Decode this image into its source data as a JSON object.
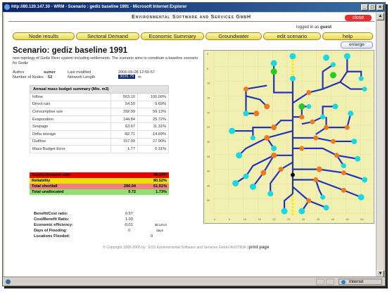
{
  "window": {
    "title": "http://80.120.147.30 - WRM - Scenario : gediz baseline 1991 - Microsoft Internet Explorer",
    "status_zone": "Internet"
  },
  "header": {
    "company": "Environmental Software and Services GmbH",
    "close_label": "close",
    "logged_in_prefix": "logged in as",
    "user": "guest"
  },
  "nav": {
    "items": [
      "Node results",
      "Sectoral Demand",
      "Economic Summary",
      "Groundwater",
      "edit scenario",
      "help"
    ],
    "enlarge": "enlarge"
  },
  "scenario": {
    "title": "Scenario: gediz baseline 1991",
    "description": "new topology of Gediz River system including settlements. The scenario aims to constitute a baseline scenario for Gediz",
    "author_label": "Author",
    "author": "sumer",
    "modified_label": "Last modified",
    "modified": "2006-06-08 12:55:57",
    "nodes_label": "Number of Nodes",
    "nodes": "52",
    "length_label": "Network Length",
    "length": "3026.79",
    "length_unit": "m"
  },
  "budget": {
    "header": "Annual mass budget summary (Mio. m3)",
    "rows": [
      {
        "label": "Inflow",
        "value": "563.10",
        "pct": "100.00%"
      },
      {
        "label": "Direct rain",
        "value": "54.50",
        "pct": "9.69%"
      },
      {
        "label": "Consumptive use",
        "value": "332.99",
        "pct": "59.13%"
      },
      {
        "label": "Evaporation",
        "value": "144.84",
        "pct": "25.72%"
      },
      {
        "label": "Seepage",
        "value": "63.67",
        "pct": "11.31%"
      },
      {
        "label": "Delta storage",
        "value": "-82.71",
        "pct": "-14.69%"
      },
      {
        "label": "Outflow",
        "value": "157.09",
        "pct": "27.90%"
      },
      {
        "label": "Mass Budget Error",
        "value": "1.77",
        "pct": "0.31%"
      }
    ]
  },
  "stats": [
    {
      "label": "Supply/demand ratio",
      "value": "",
      "pct": "48.53%",
      "color": "#e80000"
    },
    {
      "label": "Reliability",
      "value": "",
      "pct": "80.52%",
      "color": "#f0e000"
    },
    {
      "label": "Total shortfall",
      "value": "290.04",
      "pct": "51.51%",
      "color": "#f08080"
    },
    {
      "label": "Total unallocated",
      "value": "9.72",
      "pct": "1.73%",
      "color": "#90e070"
    }
  ],
  "indicators": {
    "bc_label": "Benefit/Cost ratio:",
    "bc": "0.57",
    "cb_label": "Cost/Benefit Ratio:",
    "cb": "1.03",
    "ee_label": "Economic efficiency:",
    "ee": "-0.01",
    "ee_unit": "$Cu/m3",
    "df_label": "Days of Flooding:",
    "df": "0",
    "df_unit": "days",
    "lf_label": "Locations Flooded:",
    "lf": "0"
  },
  "footer": {
    "text": "© Copyright 1995-2005 by : ESS  Environmental Software and Services GmbH AUSTRIA",
    "print": "print page"
  },
  "map": {
    "yticks": [
      "0",
      "5",
      "10",
      "15",
      "20",
      "25",
      "30",
      "35",
      "40",
      "45",
      "50"
    ],
    "xticks": [
      "0",
      "5",
      "10",
      "15",
      "20",
      "25",
      "30",
      "35",
      "40",
      "45",
      "50"
    ],
    "colors": {
      "background": "#f2f0b0",
      "link": "#2233bb",
      "supply": "#18d8e8",
      "demand": "#f07820",
      "reservoir": "#22cc22"
    }
  }
}
